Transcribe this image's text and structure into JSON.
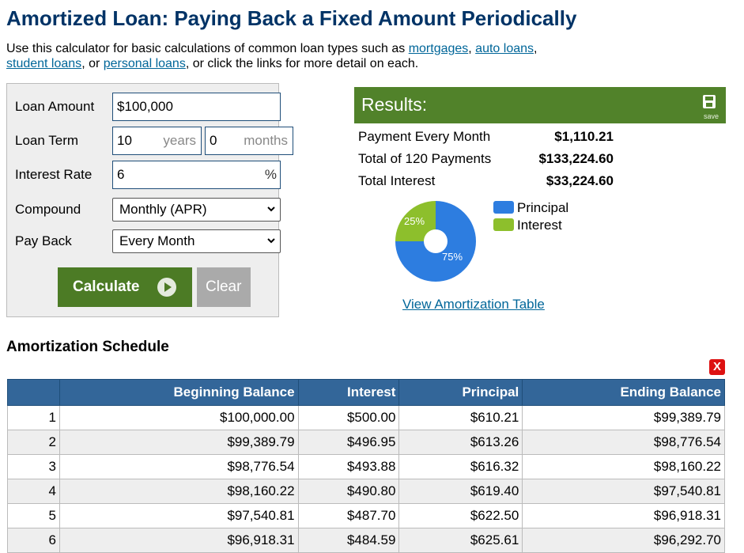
{
  "header": {
    "title": "Amortized Loan: Paying Back a Fixed Amount Periodically",
    "intro_prefix": "Use this calculator for basic calculations of common loan types such as ",
    "links": [
      "mortgages",
      "auto loans",
      "student loans",
      "personal loans"
    ],
    "sep1": ", ",
    "sep2": ", ",
    "sep3": ", or ",
    "intro_suffix": ", or click the links for more detail on each."
  },
  "form": {
    "loan_amount": {
      "label": "Loan Amount",
      "value": "$100,000"
    },
    "loan_term": {
      "label": "Loan Term",
      "years_value": "10",
      "years_unit": "years",
      "months_value": "0",
      "months_unit": "months"
    },
    "interest_rate": {
      "label": "Interest Rate",
      "value": "6",
      "unit": "%"
    },
    "compound": {
      "label": "Compound",
      "selected": "Monthly (APR)"
    },
    "pay_back": {
      "label": "Pay Back",
      "selected": "Every Month"
    },
    "calculate_label": "Calculate",
    "clear_label": "Clear"
  },
  "results": {
    "title": "Results:",
    "save_label": "save",
    "rows": [
      {
        "label": "Payment Every Month",
        "value": "$1,110.21"
      },
      {
        "label": "Total of 120 Payments",
        "value": "$133,224.60"
      },
      {
        "label": "Total Interest",
        "value": "$33,224.60"
      }
    ],
    "legend": [
      {
        "label": "Principal",
        "color": "#2d7de0"
      },
      {
        "label": "Interest",
        "color": "#8dbf2c"
      }
    ],
    "pie": {
      "principal_pct": 75,
      "interest_pct": 25,
      "principal_label": "75%",
      "interest_label": "25%"
    },
    "view_link": "View Amortization Table"
  },
  "schedule": {
    "title": "Amortization Schedule",
    "close_label": "X",
    "columns": [
      "",
      "Beginning Balance",
      "Interest",
      "Principal",
      "Ending Balance"
    ],
    "rows": [
      [
        "1",
        "$100,000.00",
        "$500.00",
        "$610.21",
        "$99,389.79"
      ],
      [
        "2",
        "$99,389.79",
        "$496.95",
        "$613.26",
        "$98,776.54"
      ],
      [
        "3",
        "$98,776.54",
        "$493.88",
        "$616.32",
        "$98,160.22"
      ],
      [
        "4",
        "$98,160.22",
        "$490.80",
        "$619.40",
        "$97,540.81"
      ],
      [
        "5",
        "$97,540.81",
        "$487.70",
        "$622.50",
        "$96,918.31"
      ],
      [
        "6",
        "$96,918.31",
        "$484.59",
        "$625.61",
        "$96,292.70"
      ]
    ]
  }
}
